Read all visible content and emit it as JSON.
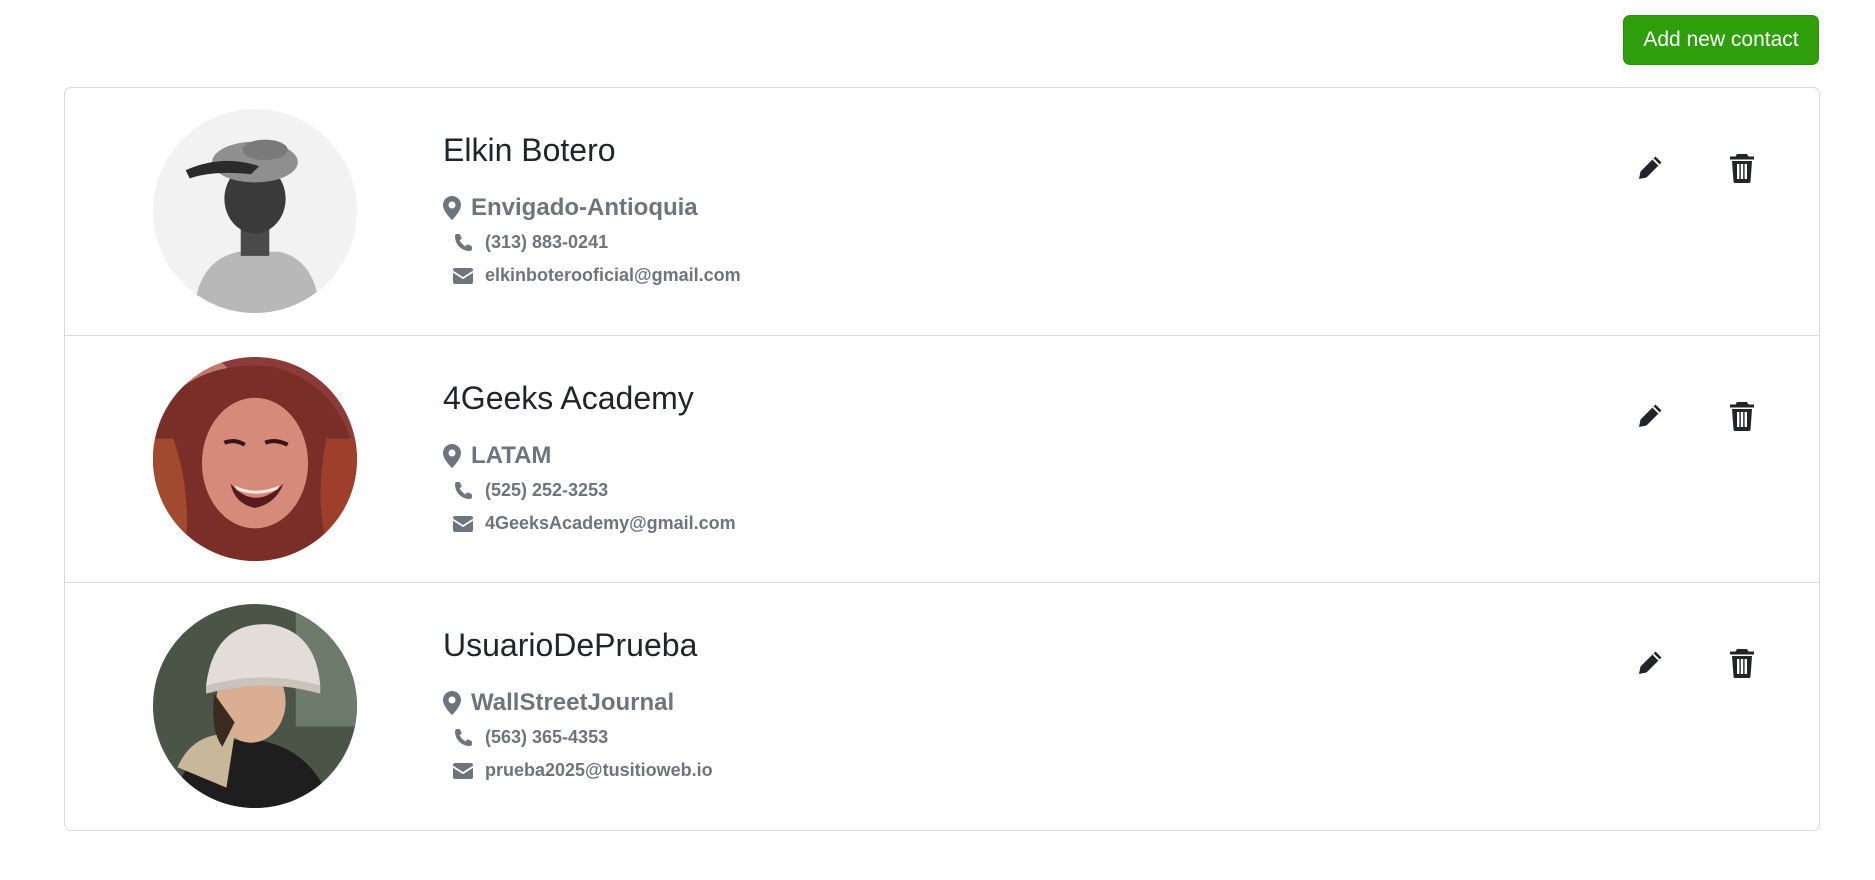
{
  "header": {
    "add_button_label": "Add new contact",
    "add_button_color": "#2f9e0b"
  },
  "contacts": [
    {
      "name": "Elkin Botero",
      "address": "Envigado-Antioquia",
      "phone": "(313) 883-0241",
      "email": "elkinboterooficial@gmail.com"
    },
    {
      "name": "4Geeks Academy",
      "address": "LATAM",
      "phone": "(525) 252-3253",
      "email": "4GeeksAcademy@gmail.com"
    },
    {
      "name": "UsuarioDePrueba",
      "address": "WallStreetJournal",
      "phone": "(563) 365-4353",
      "email": "prueba2025@tusitioweb.io"
    }
  ],
  "icons": {
    "location": "location-pin-icon",
    "phone": "phone-icon",
    "email": "envelope-icon",
    "edit": "pencil-icon",
    "delete": "trash-icon"
  },
  "colors": {
    "secondary_text": "#6c757d",
    "primary_text": "#212529",
    "border": "#d9d9d9"
  }
}
